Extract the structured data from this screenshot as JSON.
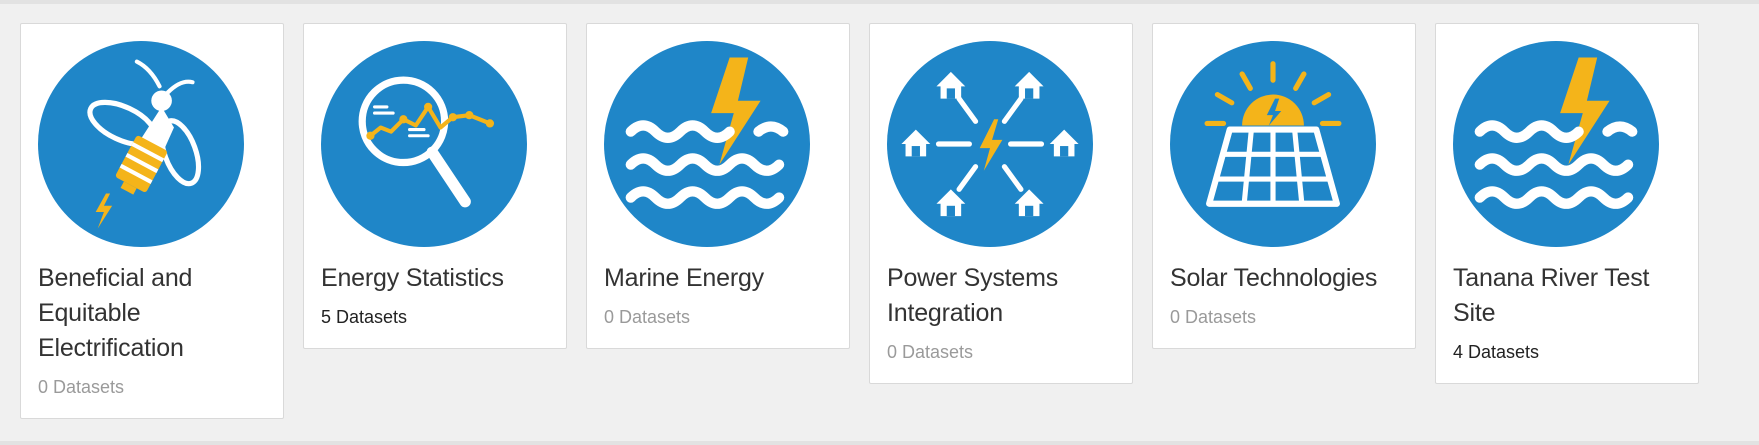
{
  "colors": {
    "icon_blue": "#1f86c8",
    "icon_yellow": "#f4b41a",
    "icon_white": "#ffffff",
    "count_zero": "#9a9a9a",
    "count_nonzero": "#222222"
  },
  "cards": [
    {
      "title": "Beneficial and Equitable Electrification",
      "count": "0 Datasets",
      "icon": "lightning-bug-icon"
    },
    {
      "title": "Energy Statistics",
      "count": "5 Datasets",
      "icon": "magnifying-glass-chart-icon"
    },
    {
      "title": "Marine Energy",
      "count": "0 Datasets",
      "icon": "waves-lightning-icon"
    },
    {
      "title": "Power Systems Integration",
      "count": "0 Datasets",
      "icon": "power-network-houses-icon"
    },
    {
      "title": "Solar Technologies",
      "count": "0 Datasets",
      "icon": "solar-panel-sun-icon"
    },
    {
      "title": "Tanana River Test Site",
      "count": "4 Datasets",
      "icon": "waves-lightning-icon"
    }
  ]
}
